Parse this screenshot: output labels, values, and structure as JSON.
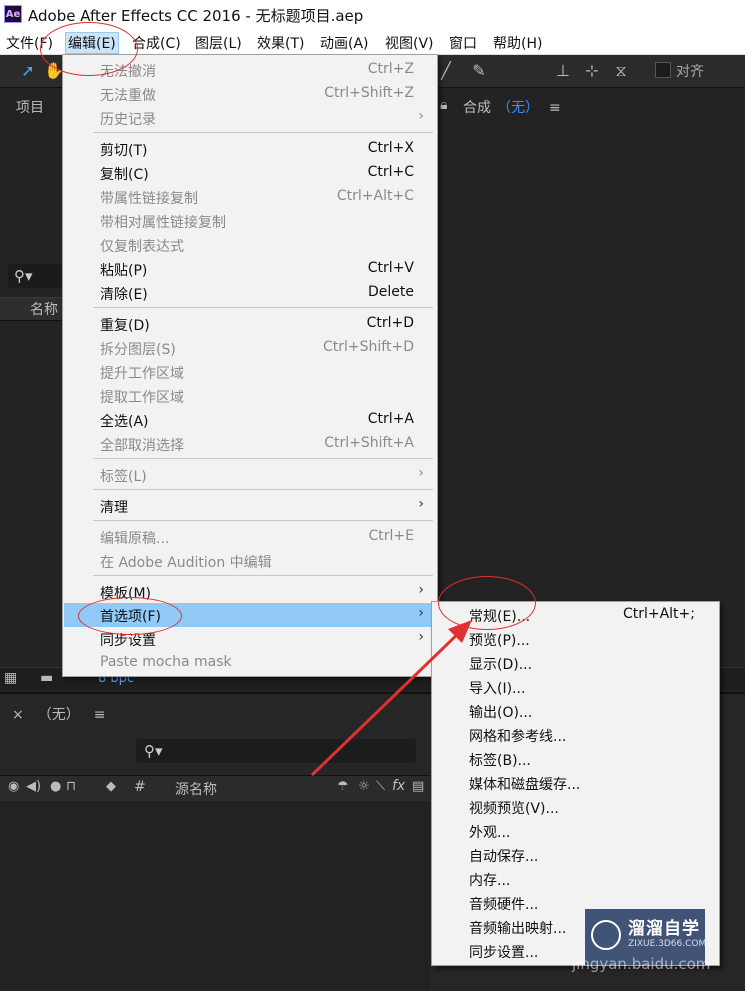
{
  "window": {
    "app_icon": "Ae",
    "title": "Adobe After Effects CC 2016 - 无标题项目.aep"
  },
  "menubar": {
    "items": [
      "文件(F)",
      "编辑(E)",
      "合成(C)",
      "图层(L)",
      "效果(T)",
      "动画(A)",
      "视图(V)",
      "窗口",
      "帮助(H)"
    ]
  },
  "toolbar": {
    "align_label": "对齐"
  },
  "project_panel": {
    "title": "项目",
    "name_column": "名称",
    "bit_depth": "8 bpc"
  },
  "composition_panel": {
    "title": "合成",
    "value": "（无）"
  },
  "timeline": {
    "title": "（无）",
    "columns": {
      "hash": "#",
      "source_name": "源名称"
    }
  },
  "edit_menu": {
    "items": [
      {
        "label": "无法撤消",
        "shortcut": "Ctrl+Z",
        "disabled": true
      },
      {
        "label": "无法重做",
        "shortcut": "Ctrl+Shift+Z",
        "disabled": true
      },
      {
        "label": "历史记录",
        "shortcut": "",
        "disabled": true,
        "submenu": true
      },
      {
        "label": "剪切(T)",
        "shortcut": "Ctrl+X",
        "disabled": false
      },
      {
        "label": "复制(C)",
        "shortcut": "Ctrl+C",
        "disabled": false
      },
      {
        "label": "带属性链接复制",
        "shortcut": "Ctrl+Alt+C",
        "disabled": true
      },
      {
        "label": "带相对属性链接复制",
        "shortcut": "",
        "disabled": true
      },
      {
        "label": "仅复制表达式",
        "shortcut": "",
        "disabled": true
      },
      {
        "label": "粘贴(P)",
        "shortcut": "Ctrl+V",
        "disabled": false
      },
      {
        "label": "清除(E)",
        "shortcut": "Delete",
        "disabled": false
      },
      {
        "label": "重复(D)",
        "shortcut": "Ctrl+D",
        "disabled": false
      },
      {
        "label": "拆分图层(S)",
        "shortcut": "Ctrl+Shift+D",
        "disabled": true
      },
      {
        "label": "提升工作区域",
        "shortcut": "",
        "disabled": true
      },
      {
        "label": "提取工作区域",
        "shortcut": "",
        "disabled": true
      },
      {
        "label": "全选(A)",
        "shortcut": "Ctrl+A",
        "disabled": false
      },
      {
        "label": "全部取消选择",
        "shortcut": "Ctrl+Shift+A",
        "disabled": true
      },
      {
        "label": "标签(L)",
        "shortcut": "",
        "disabled": true,
        "submenu": true
      },
      {
        "label": "清理",
        "shortcut": "",
        "disabled": false,
        "submenu": true
      },
      {
        "label": "编辑原稿...",
        "shortcut": "Ctrl+E",
        "disabled": true
      },
      {
        "label": "在 Adobe Audition 中编辑",
        "shortcut": "",
        "disabled": true
      },
      {
        "label": "模板(M)",
        "shortcut": "",
        "disabled": false,
        "submenu": true
      },
      {
        "label": "首选项(F)",
        "shortcut": "",
        "disabled": false,
        "submenu": true,
        "highlighted": true
      },
      {
        "label": "同步设置",
        "shortcut": "",
        "disabled": false,
        "submenu": true
      },
      {
        "label": "Paste mocha mask",
        "shortcut": "",
        "disabled": true
      }
    ]
  },
  "preferences_submenu": {
    "items": [
      {
        "label": "常规(E)...",
        "shortcut": "Ctrl+Alt+;"
      },
      {
        "label": "预览(P)...",
        "shortcut": ""
      },
      {
        "label": "显示(D)...",
        "shortcut": ""
      },
      {
        "label": "导入(I)...",
        "shortcut": ""
      },
      {
        "label": "输出(O)...",
        "shortcut": ""
      },
      {
        "label": "网格和参考线...",
        "shortcut": ""
      },
      {
        "label": "标签(B)...",
        "shortcut": ""
      },
      {
        "label": "媒体和磁盘缓存...",
        "shortcut": ""
      },
      {
        "label": "视频预览(V)...",
        "shortcut": ""
      },
      {
        "label": "外观...",
        "shortcut": ""
      },
      {
        "label": "自动保存...",
        "shortcut": ""
      },
      {
        "label": "内存...",
        "shortcut": ""
      },
      {
        "label": "音频硬件...",
        "shortcut": ""
      },
      {
        "label": "音频输出映射...",
        "shortcut": ""
      },
      {
        "label": "同步设置...",
        "shortcut": ""
      }
    ]
  },
  "watermark": {
    "brand": "溜溜自学",
    "url": "ZIXUE.3D66.COM",
    "baidu": "jingyan.baidu.com"
  },
  "colors": {
    "menu_highlight": "#91c9f7",
    "annotation": "#e03030",
    "panel_bg": "#232323",
    "comp_none": "#2f8fff"
  }
}
